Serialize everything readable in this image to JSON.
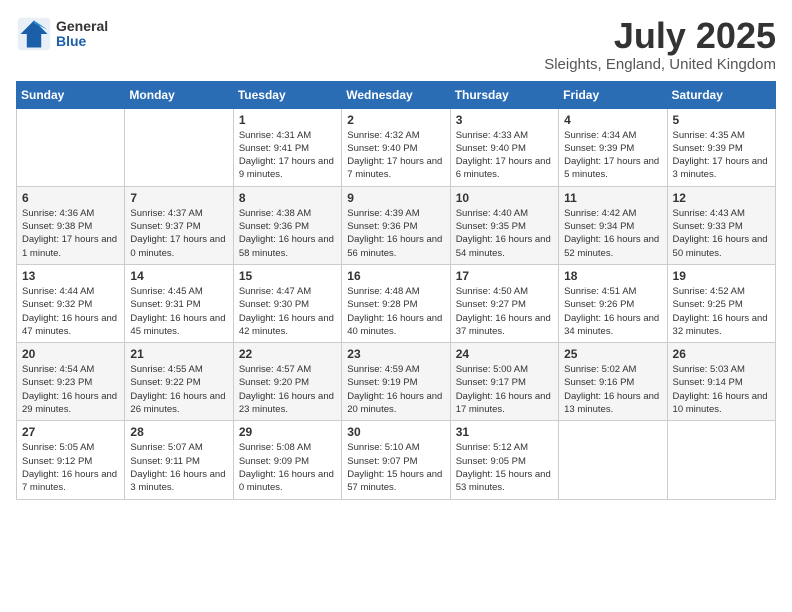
{
  "header": {
    "logo_general": "General",
    "logo_blue": "Blue",
    "month_title": "July 2025",
    "location": "Sleights, England, United Kingdom"
  },
  "weekdays": [
    "Sunday",
    "Monday",
    "Tuesday",
    "Wednesday",
    "Thursday",
    "Friday",
    "Saturday"
  ],
  "weeks": [
    [
      {
        "day": "",
        "info": ""
      },
      {
        "day": "",
        "info": ""
      },
      {
        "day": "1",
        "info": "Sunrise: 4:31 AM\nSunset: 9:41 PM\nDaylight: 17 hours and 9 minutes."
      },
      {
        "day": "2",
        "info": "Sunrise: 4:32 AM\nSunset: 9:40 PM\nDaylight: 17 hours and 7 minutes."
      },
      {
        "day": "3",
        "info": "Sunrise: 4:33 AM\nSunset: 9:40 PM\nDaylight: 17 hours and 6 minutes."
      },
      {
        "day": "4",
        "info": "Sunrise: 4:34 AM\nSunset: 9:39 PM\nDaylight: 17 hours and 5 minutes."
      },
      {
        "day": "5",
        "info": "Sunrise: 4:35 AM\nSunset: 9:39 PM\nDaylight: 17 hours and 3 minutes."
      }
    ],
    [
      {
        "day": "6",
        "info": "Sunrise: 4:36 AM\nSunset: 9:38 PM\nDaylight: 17 hours and 1 minute."
      },
      {
        "day": "7",
        "info": "Sunrise: 4:37 AM\nSunset: 9:37 PM\nDaylight: 17 hours and 0 minutes."
      },
      {
        "day": "8",
        "info": "Sunrise: 4:38 AM\nSunset: 9:36 PM\nDaylight: 16 hours and 58 minutes."
      },
      {
        "day": "9",
        "info": "Sunrise: 4:39 AM\nSunset: 9:36 PM\nDaylight: 16 hours and 56 minutes."
      },
      {
        "day": "10",
        "info": "Sunrise: 4:40 AM\nSunset: 9:35 PM\nDaylight: 16 hours and 54 minutes."
      },
      {
        "day": "11",
        "info": "Sunrise: 4:42 AM\nSunset: 9:34 PM\nDaylight: 16 hours and 52 minutes."
      },
      {
        "day": "12",
        "info": "Sunrise: 4:43 AM\nSunset: 9:33 PM\nDaylight: 16 hours and 50 minutes."
      }
    ],
    [
      {
        "day": "13",
        "info": "Sunrise: 4:44 AM\nSunset: 9:32 PM\nDaylight: 16 hours and 47 minutes."
      },
      {
        "day": "14",
        "info": "Sunrise: 4:45 AM\nSunset: 9:31 PM\nDaylight: 16 hours and 45 minutes."
      },
      {
        "day": "15",
        "info": "Sunrise: 4:47 AM\nSunset: 9:30 PM\nDaylight: 16 hours and 42 minutes."
      },
      {
        "day": "16",
        "info": "Sunrise: 4:48 AM\nSunset: 9:28 PM\nDaylight: 16 hours and 40 minutes."
      },
      {
        "day": "17",
        "info": "Sunrise: 4:50 AM\nSunset: 9:27 PM\nDaylight: 16 hours and 37 minutes."
      },
      {
        "day": "18",
        "info": "Sunrise: 4:51 AM\nSunset: 9:26 PM\nDaylight: 16 hours and 34 minutes."
      },
      {
        "day": "19",
        "info": "Sunrise: 4:52 AM\nSunset: 9:25 PM\nDaylight: 16 hours and 32 minutes."
      }
    ],
    [
      {
        "day": "20",
        "info": "Sunrise: 4:54 AM\nSunset: 9:23 PM\nDaylight: 16 hours and 29 minutes."
      },
      {
        "day": "21",
        "info": "Sunrise: 4:55 AM\nSunset: 9:22 PM\nDaylight: 16 hours and 26 minutes."
      },
      {
        "day": "22",
        "info": "Sunrise: 4:57 AM\nSunset: 9:20 PM\nDaylight: 16 hours and 23 minutes."
      },
      {
        "day": "23",
        "info": "Sunrise: 4:59 AM\nSunset: 9:19 PM\nDaylight: 16 hours and 20 minutes."
      },
      {
        "day": "24",
        "info": "Sunrise: 5:00 AM\nSunset: 9:17 PM\nDaylight: 16 hours and 17 minutes."
      },
      {
        "day": "25",
        "info": "Sunrise: 5:02 AM\nSunset: 9:16 PM\nDaylight: 16 hours and 13 minutes."
      },
      {
        "day": "26",
        "info": "Sunrise: 5:03 AM\nSunset: 9:14 PM\nDaylight: 16 hours and 10 minutes."
      }
    ],
    [
      {
        "day": "27",
        "info": "Sunrise: 5:05 AM\nSunset: 9:12 PM\nDaylight: 16 hours and 7 minutes."
      },
      {
        "day": "28",
        "info": "Sunrise: 5:07 AM\nSunset: 9:11 PM\nDaylight: 16 hours and 3 minutes."
      },
      {
        "day": "29",
        "info": "Sunrise: 5:08 AM\nSunset: 9:09 PM\nDaylight: 16 hours and 0 minutes."
      },
      {
        "day": "30",
        "info": "Sunrise: 5:10 AM\nSunset: 9:07 PM\nDaylight: 15 hours and 57 minutes."
      },
      {
        "day": "31",
        "info": "Sunrise: 5:12 AM\nSunset: 9:05 PM\nDaylight: 15 hours and 53 minutes."
      },
      {
        "day": "",
        "info": ""
      },
      {
        "day": "",
        "info": ""
      }
    ]
  ]
}
